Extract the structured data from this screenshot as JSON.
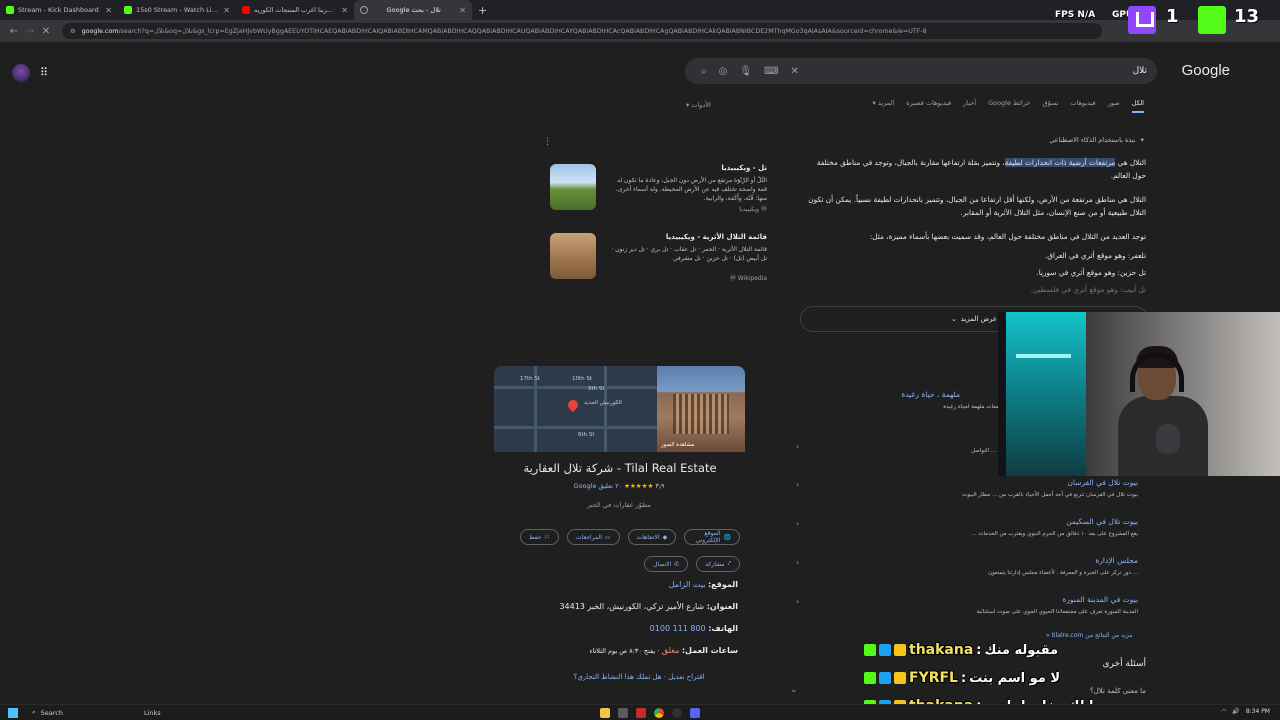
{
  "browser": {
    "tabs": [
      {
        "title": "Stream - Kick Dashboard",
        "favicon_color": "#53fc18",
        "active": false
      },
      {
        "title": "15s0 Stream - Watch Live on K",
        "favicon_color": "#53fc18",
        "active": false
      },
      {
        "title": "جربنا اغرب المنتجات الكوريه 😨👀",
        "favicon_color": "#ff0000",
        "active": false
      },
      {
        "title": "تلال - بحث Google",
        "favicon_color": "#9aa0a6",
        "active": true
      }
    ],
    "new_tab": "+",
    "url_host": "google.com",
    "url_rest": "/search?q=تلال&oq=تلال&gs_lcrp=EgZjaHJvbWUyBggAEEUYOTIHCAEQABiABDIHCAIQABiABDIHCAMQABiABDIHCAQQABiABDIHCAUQABiABDIHCAYQABiABDIHCAcQABiABDIHCAgQABiABDIHCAkQABiABNIBCDE2MThqMGo3qAIAsAIA&sourceid=chrome&ie=UTF-8"
  },
  "google": {
    "logo": "Google",
    "query": "تلال",
    "tabs": [
      "الكل",
      "صور",
      "فيديوهات",
      "تسوّق",
      "خرائط Google",
      "أخبار",
      "فيديوهات قصيرة",
      "المزيد"
    ],
    "tools": "الأدوات",
    "ai_overview": {
      "label": "نبذة باستخدام الذكاء الاصطناعي",
      "p1_pre": "التلال هي ",
      "p1_hl": "مرتفعات أرضية ذات انحدارات لطيفة",
      "p1_post": "، وتتميز بقلة ارتفاعها مقارنة بالجبال، وتوجد في مناطق مختلفة حول العالم.",
      "p2": "التلال هي مناطق مرتفعة من الأرض، ولكنها أقل ارتفاعا من الجبال، وتتميز بانحدارات لطيفة نسبياً. يمكن أن تكون التلال طبيعية أو من صنع الإنسان، مثل التلال الأثرية أو المقابر.",
      "p3": "توجد العديد من التلال في مناطق مختلفة حول العالم، وقد سميت بعضها بأسماء مميزة، مثل:",
      "items": [
        "تلعفر: وهو موقع أثري في العراق.",
        "تل حزين: وهو موقع أثري في سوريا.",
        "تل أبيب: وهو موقع أثري في فلسطين."
      ],
      "show_more": "عرض المزيد"
    },
    "sources": [
      {
        "title": "تل - ويكيبيديا",
        "desc": "التَّلّ أو الرَّبْوَة مرتفع من الأرض دون الجبل، وعادة ما تكون له قمة واضحة تختلف فيه عن الأرض المحيطة. وله أسماء أخرى، منها: قُنّة، وأَكَمَة، والرابية.",
        "site": "ويكيبيديا"
      },
      {
        "title": "قائمة التلال الأثرية - ويكيبيديا",
        "desc": "قائمة التلال الأثرية · الحمر · تل عقاب · تل بري · تل دير زنون · تل أبيض (تل) · تل حزين · تل مشرفي",
        "site": "Wikipedia"
      }
    ],
    "knowledge_panel": {
      "map_labels": [
        "17th St",
        "10th St",
        "9th St",
        "6th St",
        "الكورنيش الجديد"
      ],
      "photo_caption": "مشاهدة الصور",
      "title": "Tilal Real Estate - شركة تلال العقارية",
      "rating": "٣٫٩",
      "stars": "★★★★★",
      "reviews": "٢٠ تعليق Google",
      "category": "مطوّر عقارات في الخبر",
      "buttons": [
        "الموقع الإلكتروني",
        "الاتجاهات",
        "المراجعات",
        "حفظ"
      ],
      "button_call": "الاتصال",
      "button_share": "مشاركة",
      "location_label": "الموقع:",
      "location_value": "بيت الزامل",
      "address_label": "العنوان:",
      "address_value": "شارع الأمير تركي، الكورنيش، الخبر 34413",
      "phone_label": "الهاتف:",
      "phone_value": "800 111 0100",
      "hours_label": "ساعات العمل:",
      "hours_status": "مغلق",
      "hours_value": "· يفتح ٨:٣٠ ص يوم الثلاثاء",
      "suggest": "اقتراح تعديل · هل تملك هذا النشاط التجاري؟"
    },
    "results": [
      {
        "title": "ملهمة ، حياة رغيدة",
        "desc": "... على من عدد من المملكة مع تلال العقارية. تلتحق تبني مجتمعات ملهمة لحياة رغيدة"
      },
      {
        "title": "",
        "desc": "... التواصل"
      },
      {
        "title": "بيوت تلال في الفرسان",
        "desc": "بيوت تلال في الفرسان تتربع في أحد أجمل الأحياء بالقرب من ... مطار البيوت"
      },
      {
        "title": "بيوت تلال في السكيمن",
        "desc": "يقع المشروع على بعد ١٠ دقائق من الحرم النبوي ويقترب من الخدمات ..."
      },
      {
        "title": "مجلس الإدارة",
        "desc": "... دور تركز على الخبرة و المعرفة . لأعضاء مجلس إدارتنا يتمتعون"
      },
      {
        "title": "بيوت في المدينة المنورة",
        "desc": "المدينة المنورة تعرف على مجتمعاتنا الحيوي الجوي على صوت استثنائية"
      }
    ],
    "more_results": "مزيد من النتائج من tilalre.com »",
    "paa_title": "أسئلة أخرى",
    "paa_q1": "ما معنى كلمة تلال؟"
  },
  "overlay": {
    "fps_label": "FPS",
    "fps_value": "N/A",
    "gpu_label": "GPU",
    "counter_1": "1",
    "counter_2": "13",
    "chat": [
      {
        "user": "thakana",
        "msg": "مقبوله منك"
      },
      {
        "user": "FYRFL",
        "msg": "لا مو اسم بنت"
      },
      {
        "user": "thakana",
        "msg": "ما لك دخل يا بادور"
      }
    ]
  },
  "taskbar": {
    "search": "Search",
    "links": "Links",
    "time": "8:34 PM"
  },
  "colors": {
    "accent_link": "#8ab4f8",
    "kick_green": "#53fc18",
    "twitch_purple": "#9146ff",
    "chat_name": "#f2e15c"
  }
}
